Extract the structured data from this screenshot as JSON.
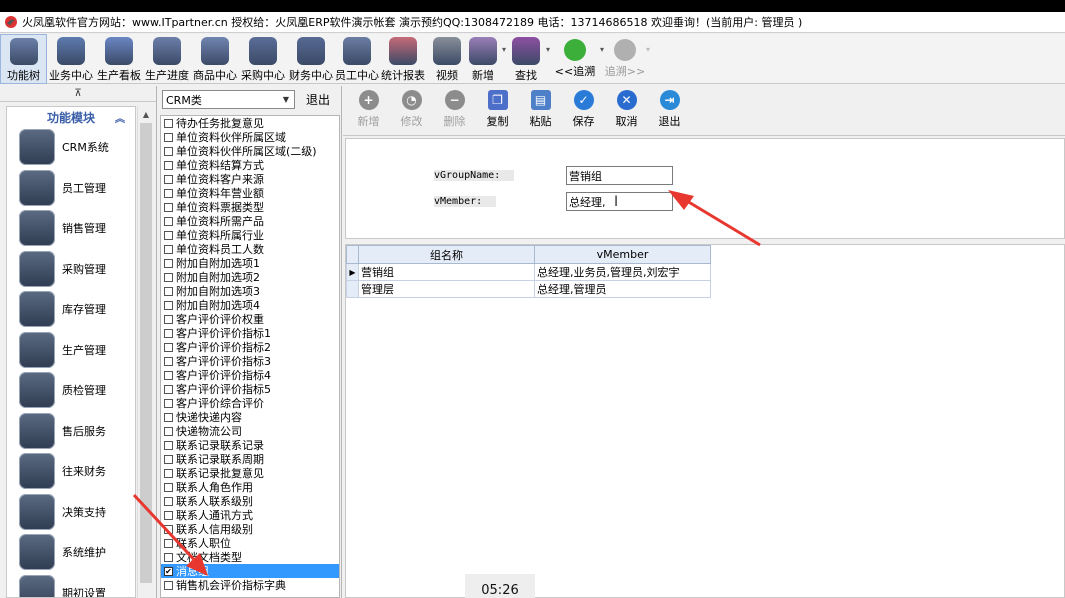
{
  "window": {
    "title": "火凤凰软件官方网站：www.ITpartner.cn  授权给：火凤凰ERP软件演示帐套 演示预约QQ:1308472189  电话：13714686518  欢迎垂询！(当前用户: 管理员 )"
  },
  "main_toolbar": {
    "items": [
      {
        "label": "功能树",
        "icon": "function-tree-icon",
        "color": "#6b7fa8"
      },
      {
        "label": "业务中心",
        "icon": "business-center-icon",
        "color": "#5d7bb0"
      },
      {
        "label": "生产看板",
        "icon": "production-board-icon",
        "color": "#6a86c4"
      },
      {
        "label": "生产进度",
        "icon": "production-progress-icon",
        "color": "#6c7faa"
      },
      {
        "label": "商品中心",
        "icon": "product-center-icon",
        "color": "#7185b1"
      },
      {
        "label": "采购中心",
        "icon": "purchase-center-icon",
        "color": "#5b6e99"
      },
      {
        "label": "财务中心",
        "icon": "finance-center-icon",
        "color": "#566a94"
      },
      {
        "label": "员工中心",
        "icon": "employee-center-icon",
        "color": "#6b7da3"
      },
      {
        "label": "统计报表",
        "icon": "statistics-report-icon",
        "color": "#c86b78"
      },
      {
        "label": "视频",
        "icon": "video-icon",
        "color": "#8a8f99"
      },
      {
        "label": "新增",
        "icon": "add-new-icon",
        "color": "#9a7fb8"
      },
      {
        "label": "查找",
        "icon": "find-icon",
        "color": "#8e4fa3"
      },
      {
        "label": "<<追溯",
        "icon": "trace-back-icon",
        "color": "#3cae3a"
      },
      {
        "label": "追溯>>",
        "icon": "trace-forward-icon",
        "color": "#b0b0b0"
      }
    ]
  },
  "left_panel": {
    "collapse_glyph": "⊼",
    "header": "功能模块",
    "modules": [
      {
        "label": "CRM系统",
        "icon": "crm-icon"
      },
      {
        "label": "员工管理",
        "icon": "employee-management-icon"
      },
      {
        "label": "销售管理",
        "icon": "sales-management-icon"
      },
      {
        "label": "采购管理",
        "icon": "purchase-management-icon"
      },
      {
        "label": "库存管理",
        "icon": "inventory-management-icon"
      },
      {
        "label": "生产管理",
        "icon": "production-management-icon"
      },
      {
        "label": "质检管理",
        "icon": "quality-inspection-icon"
      },
      {
        "label": "售后服务",
        "icon": "after-sales-icon"
      },
      {
        "label": "往来财务",
        "icon": "finance-icon"
      },
      {
        "label": "决策支持",
        "icon": "decision-support-icon"
      },
      {
        "label": "系统维护",
        "icon": "system-maintenance-icon"
      },
      {
        "label": "期初设置",
        "icon": "initial-settings-icon"
      }
    ]
  },
  "category_panel": {
    "selected_category": "CRM类",
    "exit_label": "退出",
    "items": [
      {
        "label": "待办任务批复意见",
        "checked": false
      },
      {
        "label": "单位资料伙伴所属区域",
        "checked": false
      },
      {
        "label": "单位资料伙伴所属区域(二级)",
        "checked": false
      },
      {
        "label": "单位资料结算方式",
        "checked": false
      },
      {
        "label": "单位资料客户来源",
        "checked": false
      },
      {
        "label": "单位资料年营业额",
        "checked": false
      },
      {
        "label": "单位资料票据类型",
        "checked": false
      },
      {
        "label": "单位资料所需产品",
        "checked": false
      },
      {
        "label": "单位资料所属行业",
        "checked": false
      },
      {
        "label": "单位资料员工人数",
        "checked": false
      },
      {
        "label": "附加自附加选项1",
        "checked": false
      },
      {
        "label": "附加自附加选项2",
        "checked": false
      },
      {
        "label": "附加自附加选项3",
        "checked": false
      },
      {
        "label": "附加自附加选项4",
        "checked": false
      },
      {
        "label": "客户评价评价权重",
        "checked": false
      },
      {
        "label": "客户评价评价指标1",
        "checked": false
      },
      {
        "label": "客户评价评价指标2",
        "checked": false
      },
      {
        "label": "客户评价评价指标3",
        "checked": false
      },
      {
        "label": "客户评价评价指标4",
        "checked": false
      },
      {
        "label": "客户评价评价指标5",
        "checked": false
      },
      {
        "label": "客户评价综合评价",
        "checked": false
      },
      {
        "label": "快递快递内容",
        "checked": false
      },
      {
        "label": "快递物流公司",
        "checked": false
      },
      {
        "label": "联系记录联系记录",
        "checked": false
      },
      {
        "label": "联系记录联系周期",
        "checked": false
      },
      {
        "label": "联系记录批复意见",
        "checked": false
      },
      {
        "label": "联系人角色作用",
        "checked": false
      },
      {
        "label": "联系人联系级别",
        "checked": false
      },
      {
        "label": "联系人通讯方式",
        "checked": false
      },
      {
        "label": "联系人信用级别",
        "checked": false
      },
      {
        "label": "联系人职位",
        "checked": false
      },
      {
        "label": "文档文档类型",
        "checked": false
      },
      {
        "label": "消息组",
        "checked": true
      },
      {
        "label": "销售机会评价指标字典",
        "checked": false
      }
    ],
    "selected_index": 32
  },
  "right_toolbar": {
    "items": [
      {
        "label": "新增",
        "icon": "add-icon",
        "enabled": false,
        "color": "#8c8c8c",
        "glyph": "+"
      },
      {
        "label": "修改",
        "icon": "edit-icon",
        "enabled": false,
        "color": "#8c8c8c",
        "glyph": "◔"
      },
      {
        "label": "删除",
        "icon": "delete-icon",
        "enabled": false,
        "color": "#8c8c8c",
        "glyph": "−"
      },
      {
        "label": "复制",
        "icon": "copy-icon",
        "enabled": true,
        "color": "#4e6fc9",
        "glyph": "❐"
      },
      {
        "label": "粘贴",
        "icon": "paste-icon",
        "enabled": true,
        "color": "#4e7fc9",
        "glyph": "▤"
      },
      {
        "label": "保存",
        "icon": "save-icon",
        "enabled": true,
        "color": "#2a7ad8",
        "glyph": "✓"
      },
      {
        "label": "取消",
        "icon": "cancel-icon",
        "enabled": true,
        "color": "#2a6bd0",
        "glyph": "✕"
      },
      {
        "label": "退出",
        "icon": "exit-icon",
        "enabled": true,
        "color": "#2a8ad8",
        "glyph": "⇥"
      }
    ]
  },
  "form": {
    "group_name_label": "vGroupName:",
    "group_name_value": "营销组",
    "member_label": "vMember:",
    "member_value": "总经理,"
  },
  "grid": {
    "columns": [
      "组名称",
      "vMember"
    ],
    "rows": [
      {
        "name": "营销组",
        "member": "总经理,业务员,管理员,刘宏宇",
        "current": true
      },
      {
        "name": "管理层",
        "member": "总经理,管理员",
        "current": false
      }
    ],
    "current_row_glyph": "▶"
  },
  "timer": {
    "text": "05:26"
  },
  "annotation_color": "#e8372f"
}
